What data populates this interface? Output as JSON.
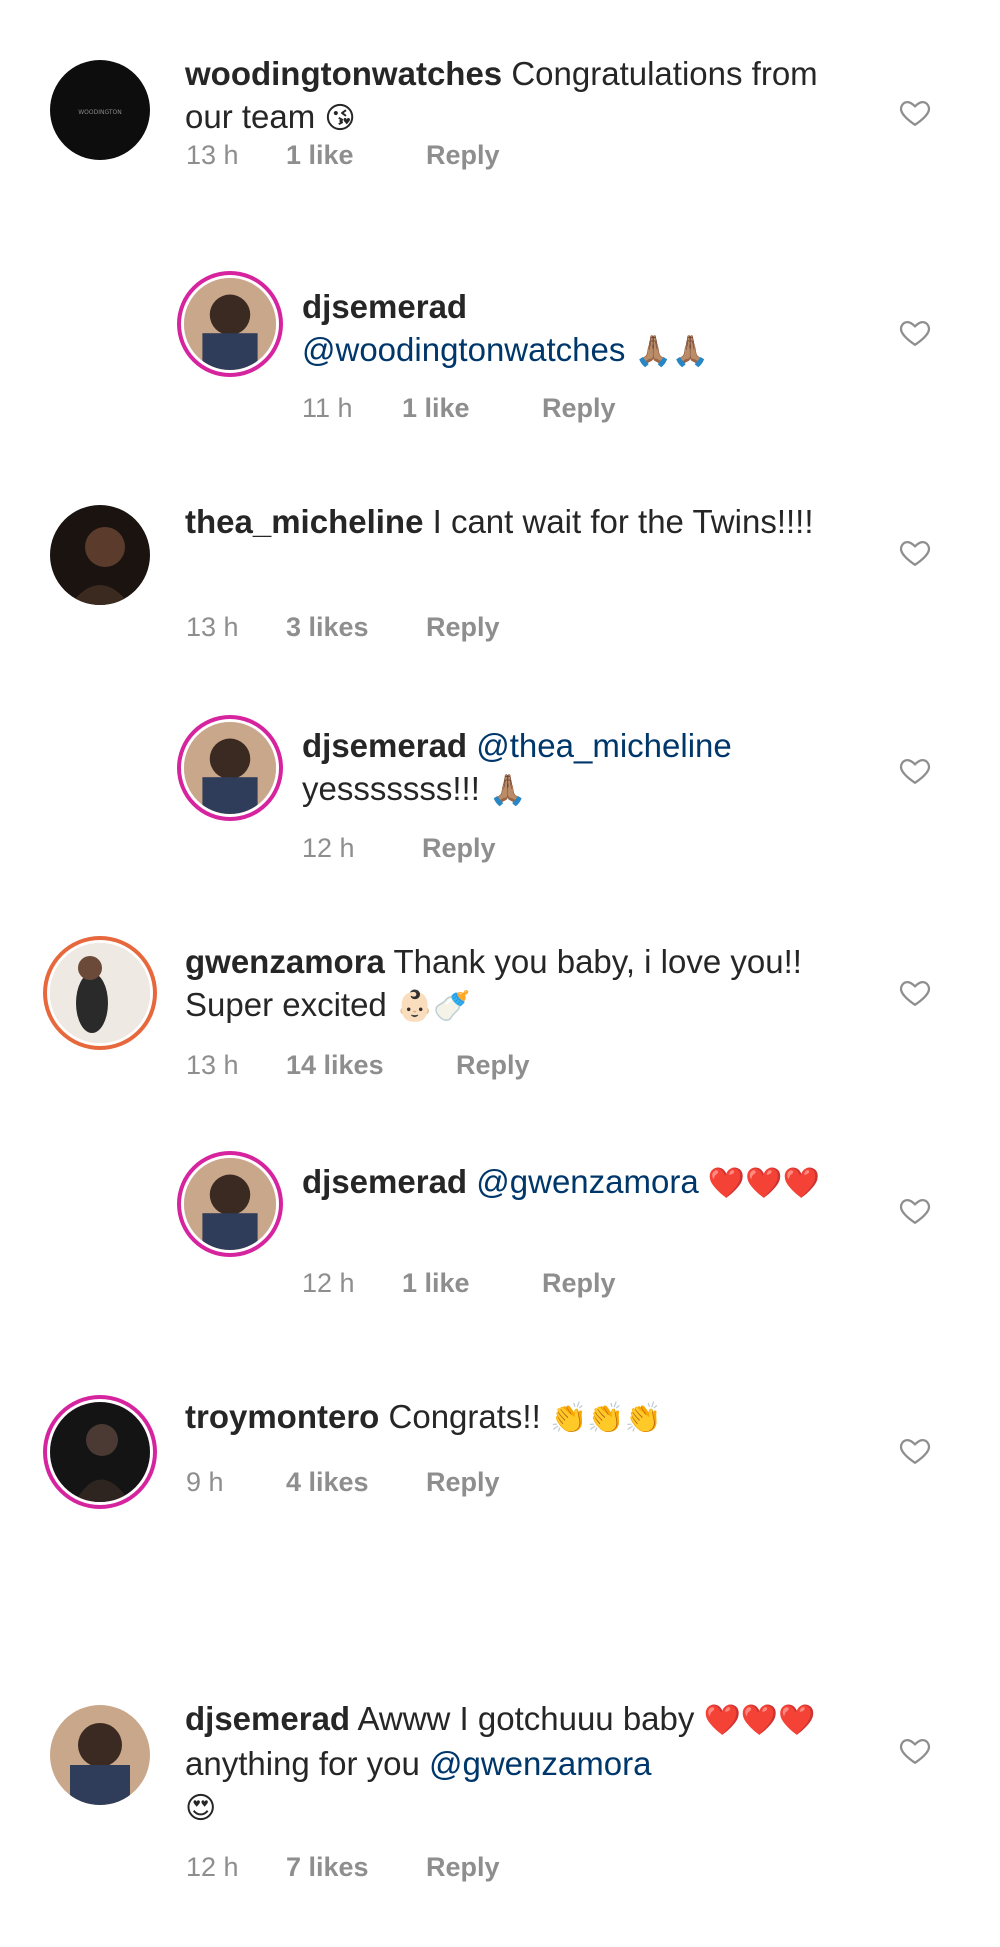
{
  "comments": [
    {
      "user": "woodingtonwatches",
      "text": "Congratulations from our team",
      "emoji": "😘",
      "time": "13 h",
      "likes": "1 like",
      "reply": "Reply"
    },
    {
      "user": "djsemerad",
      "mention": "@woodingtonwatches",
      "emoji": "🙏🏽🙏🏽",
      "time": "11 h",
      "likes": "1 like",
      "reply": "Reply"
    },
    {
      "user": "thea_micheline",
      "text": "I cant wait for the Twins!!!!",
      "time": "13 h",
      "likes": "3 likes",
      "reply": "Reply"
    },
    {
      "user": "djsemerad",
      "mention": "@thea_micheline",
      "text": "yesssssss!!!",
      "emoji": "🙏🏽",
      "time": "12 h",
      "reply": "Reply"
    },
    {
      "user": "gwenzamora",
      "text": "Thank you baby, i love you!! Super excited",
      "emoji": "👶🏻🍼",
      "time": "13 h",
      "likes": "14 likes",
      "reply": "Reply"
    },
    {
      "user": "djsemerad",
      "mention": "@gwenzamora",
      "emoji": "❤️❤️❤️",
      "time": "12 h",
      "likes": "1 like",
      "reply": "Reply"
    },
    {
      "user": "troymontero",
      "text": "Congrats!!",
      "emoji": "👏👏👏",
      "time": "9 h",
      "likes": "4 likes",
      "reply": "Reply"
    },
    {
      "user": "djsemerad",
      "text": "Awww I gotchuuu baby",
      "emoji1": "❤️❤️❤️",
      "text2": "anything for you",
      "mention": "@gwenzamora",
      "emoji2": "😍",
      "time": "12 h",
      "likes": "7 likes",
      "reply": "Reply"
    }
  ],
  "icons": {
    "like": "heart-outline-icon",
    "avatar": "profile-avatar"
  },
  "colors": {
    "username": "#262626",
    "mention": "#00376b",
    "meta": "#8e8e8e",
    "heart": "#8e8e8e",
    "story_ring": "#d6249f"
  }
}
